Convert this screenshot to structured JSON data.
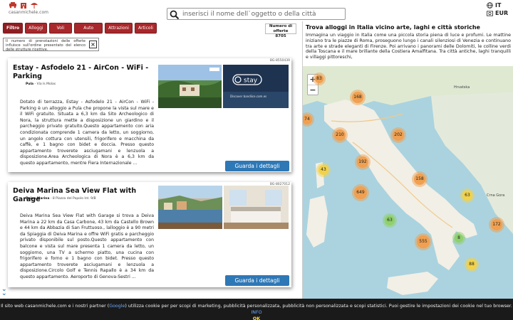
{
  "header": {
    "logo_text": "casanmichele.com",
    "search_placeholder": "inserisci il nome dell`oggetto o della città",
    "language": "IT",
    "currency": "EUR"
  },
  "filters": {
    "items": [
      "Filtro",
      "Alloggi",
      "Voli",
      "Auto",
      "Attrazioni",
      "Articoli"
    ]
  },
  "offer_count": {
    "label": "Numero di offerte",
    "value": "8705"
  },
  "notice": {
    "text": "Il numero di prenotazioni delle offerte influisce sull'ordine presentato del elenco delle strutture ricettive."
  },
  "listings": [
    {
      "code": "BG-8550439",
      "title": "Estay - Asfodelo 21 - AirCon - WiFi - Parking",
      "city": "Pula",
      "address": "Via Is Molas",
      "description": "Dotato di terrazza, Estay - Asfodelo 21 - AirCon - WiFi - Parking è un alloggio a Pula che propone la vista sul mare e il WiFi gratuito. Situata a 6,3 km da Sito Archeologico di Nora, la struttura mette a disposizione un giardino e il parcheggio privato gratuito.Questo appartamento con aria condizionata comprende 1 camera da letto, un soggiorno, un angolo cottura con utensili, frigorifero e macchina da caffè, e 1 bagno con bidet e doccia. Presso questo appartamento troverete asciugamani e lenzuola a disposizione.Area Archeologica di Nora è a 6,3 km da questo appartamento, mentre Fiera Internazionale ...",
      "button": "Guarda i dettagli",
      "photo_caption": "Discover bandiice.com.es"
    },
    {
      "code": "BG-8027012",
      "title": "Deiva Marina Sea View Flat with Garage",
      "city": "Deiva Marina",
      "address": "8 Piazza del Popolo Int. 9/B",
      "description": "Deiva Marina Sea View Flat with Garage si trova a Deiva Marina a 22 km da Casa Carbone, 43 km da Castello Brown e 44 km da Abbazia di San Fruttuoso., lalloggio è a 90 metri da Spiaggia di Deiva Marina e offre WiFi gratis e parcheggio privato disponibile sul posto.Questo appartamento con balcone e vista sul mare presenta 1 camera da letto, un soggiorno, una TV a schermo piatto, una cucina con frigorifero e forno e 1 bagno con bidet. Presso questo appartamento troverete asciugamani e lenzuola a disposizione.Circolo Golf e Tennis Rapallo è a 34 km da questo appartamento. Aeroporto di Genova-Sestri ...",
      "button": "Guarda i dettagli"
    }
  ],
  "map": {
    "title": "Trova alloggi in Italia vicino arte, laghi e città storiche",
    "text": "Immagina un viaggio in Italia come una piccola storia piena di luce e profumi. Le mattine iniziano tra le piazze di Roma, proseguono lungo i canali silenziosi di Venezia e continuano tra arte e strade eleganti di Firenze. Poi arrivano i panorami delle Dolomiti, le colline verdi della Toscana e il mare brillante della Costiera Amalfitana. Tra città antiche, laghi tranquilli e villaggi pittoreschi,",
    "zoom_in": "+",
    "zoom_out": "−",
    "clusters": [
      "83",
      "74",
      "168",
      "210",
      "202",
      "192",
      "43",
      "158",
      "649",
      "63",
      "63",
      "172",
      "555",
      "8",
      "88"
    ],
    "labels": [
      "Hrvatska",
      "Crna Gora"
    ]
  },
  "cookie": {
    "text_before": "Il sito web casanmichele.com e i nostri partner (",
    "link_google": "Google",
    "text_after": ") utilizza cookie per per scopi di marketing, pubblicità personalizzata, pubblicità non personalizzata e scopi statistici. Puoi gestire le impostazioni dei cookie nel tuo browser.",
    "link_more": "INFO",
    "ok": "OK"
  },
  "colors": {
    "brand_red": "#a8272b",
    "button_blue": "#2e78b6",
    "cluster_orange": "#f0a050",
    "cluster_yellow": "#f2d24a",
    "cluster_green": "#8fd06a",
    "sea": "#aad3df"
  }
}
